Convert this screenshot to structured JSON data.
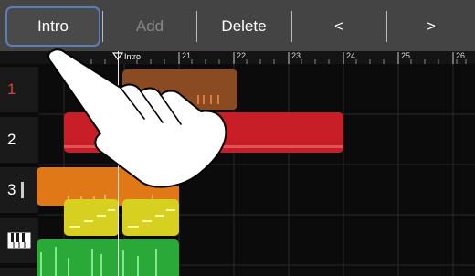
{
  "toolbar": {
    "buttons": [
      {
        "label": "Intro",
        "state": "selected"
      },
      {
        "label": "Add",
        "state": "disabled"
      },
      {
        "label": "Delete",
        "state": "enabled"
      },
      {
        "label": "<",
        "state": "enabled"
      },
      {
        "label": ">",
        "state": "enabled"
      }
    ]
  },
  "ruler": {
    "marker_name": "Intro",
    "bars": [
      "21",
      "22",
      "23",
      "24",
      "25",
      "26"
    ]
  },
  "tracks": [
    {
      "label": "1",
      "color": "#d9432f"
    },
    {
      "label": "2",
      "color": "#ffffff"
    },
    {
      "label": "3",
      "color": "#ffffff"
    },
    {
      "label": "",
      "icon": "keyboard-icon",
      "color": "#ffffff"
    },
    {
      "label": "",
      "color": "#ffffff"
    }
  ],
  "colors": {
    "track1_region": "#8a4a22",
    "track2_region": "#c81e28",
    "track3_region": "#e07818",
    "track4_region": "#d8d020",
    "track5_region": "#2aa838",
    "selection_border": "#5a7fb8",
    "toolbar_bg": "#444444"
  }
}
